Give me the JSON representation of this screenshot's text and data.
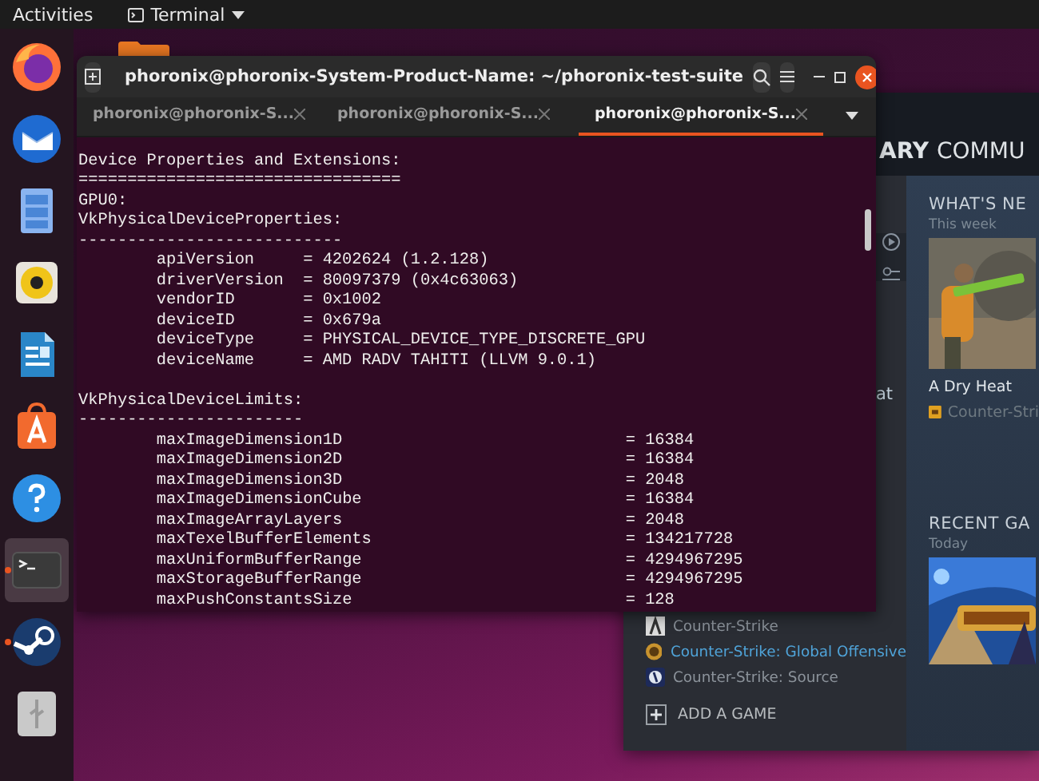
{
  "top_bar": {
    "activities": "Activities",
    "app_menu": "Terminal"
  },
  "dock": {
    "items": [
      {
        "kind": "firefox",
        "running": false,
        "active": false
      },
      {
        "kind": "mail",
        "running": false,
        "active": false
      },
      {
        "kind": "files",
        "running": false,
        "active": false
      },
      {
        "kind": "music",
        "running": false,
        "active": false
      },
      {
        "kind": "writer",
        "running": false,
        "active": false
      },
      {
        "kind": "software",
        "running": false,
        "active": false
      },
      {
        "kind": "help",
        "running": false,
        "active": false
      },
      {
        "kind": "terminal",
        "running": true,
        "active": true
      },
      {
        "kind": "steam",
        "running": true,
        "active": false
      },
      {
        "kind": "usb",
        "running": false,
        "active": false
      }
    ]
  },
  "terminal": {
    "title": "phoronix@phoronix-System-Product-Name: ~/phoronix-test-suite",
    "tabs": [
      {
        "label": "phoronix@phoronix-S...",
        "selected": false
      },
      {
        "label": "phoronix@phoronix-S...",
        "selected": false
      },
      {
        "label": "phoronix@phoronix-S...",
        "selected": true
      }
    ],
    "lines": [
      {
        "kind": "text",
        "text": "Device Properties and Extensions:"
      },
      {
        "kind": "text",
        "text": "================================="
      },
      {
        "kind": "text",
        "text": "GPU0:"
      },
      {
        "kind": "text",
        "text": "VkPhysicalDeviceProperties:"
      },
      {
        "kind": "text",
        "text": "---------------------------"
      },
      {
        "kind": "prop",
        "name": "apiVersion",
        "value": "= 4202624 (1.2.128)"
      },
      {
        "kind": "prop",
        "name": "driverVersion",
        "value": "= 80097379 (0x4c63063)"
      },
      {
        "kind": "prop",
        "name": "vendorID",
        "value": "= 0x1002"
      },
      {
        "kind": "prop",
        "name": "deviceID",
        "value": "= 0x679a"
      },
      {
        "kind": "prop",
        "name": "deviceType",
        "value": "= PHYSICAL_DEVICE_TYPE_DISCRETE_GPU"
      },
      {
        "kind": "prop",
        "name": "deviceName",
        "value": "= AMD RADV TAHITI (LLVM 9.0.1)"
      },
      {
        "kind": "blank"
      },
      {
        "kind": "text",
        "text": "VkPhysicalDeviceLimits:"
      },
      {
        "kind": "text",
        "text": "-----------------------"
      },
      {
        "kind": "limit",
        "name": "maxImageDimension1D",
        "value": "= 16384"
      },
      {
        "kind": "limit",
        "name": "maxImageDimension2D",
        "value": "= 16384"
      },
      {
        "kind": "limit",
        "name": "maxImageDimension3D",
        "value": "= 2048"
      },
      {
        "kind": "limit",
        "name": "maxImageDimensionCube",
        "value": "= 16384"
      },
      {
        "kind": "limit",
        "name": "maxImageArrayLayers",
        "value": "= 2048"
      },
      {
        "kind": "limit",
        "name": "maxTexelBufferElements",
        "value": "= 134217728"
      },
      {
        "kind": "limit",
        "name": "maxUniformBufferRange",
        "value": "= 4294967295"
      },
      {
        "kind": "limit",
        "name": "maxStorageBufferRange",
        "value": "= 4294967295"
      },
      {
        "kind": "limit",
        "name": "maxPushConstantsSize",
        "value": "= 128"
      }
    ]
  },
  "steam": {
    "nav": [
      "ARY",
      "COMMU"
    ],
    "sidebar_partial": "at",
    "games": [
      {
        "name": "Counter-Strike",
        "selected": false
      },
      {
        "name": "Counter-Strike: Global Offensive",
        "selected": true
      },
      {
        "name": "Counter-Strike: Source",
        "selected": false
      }
    ],
    "add_game": "ADD A GAME",
    "whats_new": {
      "title": "WHAT'S NE",
      "period": "This week",
      "item_title": "A Dry Heat",
      "item_game": "Counter-Stri"
    },
    "recent": {
      "title": "RECENT GA",
      "period": "Today"
    }
  }
}
